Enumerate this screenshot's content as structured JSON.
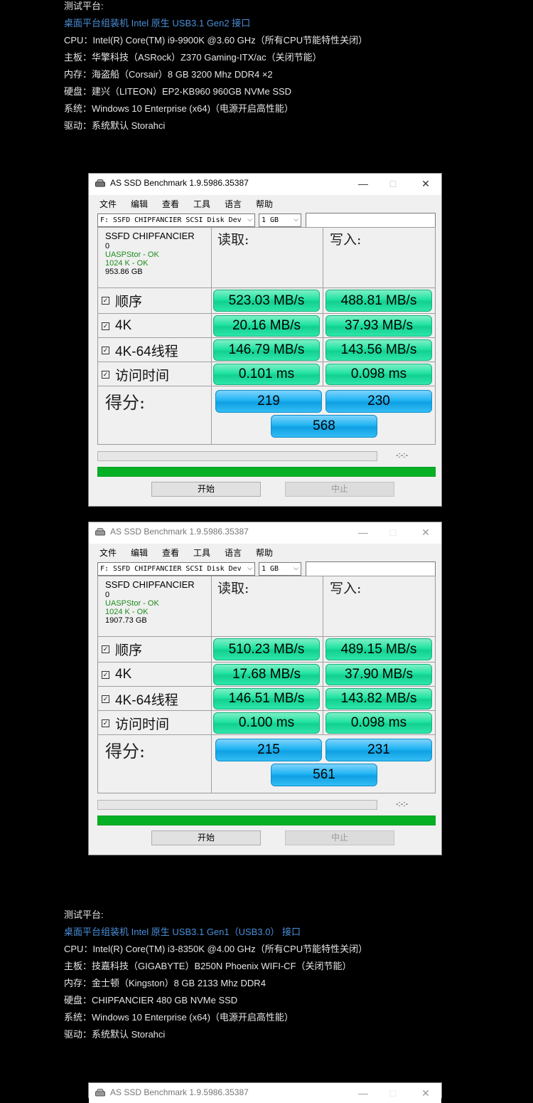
{
  "spec1": {
    "lines": [
      {
        "text": "测试平台:"
      },
      {
        "text": "桌面平台组装机 Intel 原生 USB3.1 Gen2 接口"
      },
      {
        "text": "CPU：Intel(R) Core(TM) i9-9900K @3.60 GHz（所有CPU节能特性关闭）"
      },
      {
        "text": "主板：华擎科技（ASRock）Z370 Gaming-ITX/ac（关闭节能）"
      },
      {
        "text": "内存：海盗船（Corsair）8 GB 3200 Mhz DDR4 ×2"
      },
      {
        "text": "硬盘：建兴（LITEON）EP2-KB960 960GB NVMe SSD"
      },
      {
        "text": "系统：Windows 10 Enterprise (x64)（电源开启高性能）"
      },
      {
        "text": "驱动：系统默认 Storahci"
      }
    ]
  },
  "spec2": {
    "lines": [
      {
        "text": "测试平台:"
      },
      {
        "text": "桌面平台组装机 Intel 原生 USB3.1 Gen1（USB3.0） 接口"
      },
      {
        "text": "CPU：Intel(R) Core(TM) i3-8350K @4.00 GHz（所有CPU节能特性关闭）"
      },
      {
        "text": "主板：技嘉科技（GIGABYTE）B250N Phoenix WIFI-CF（关闭节能）"
      },
      {
        "text": "内存：金士顿（Kingston）8 GB 2133 Mhz DDR4"
      },
      {
        "text": "硬盘：CHIPFANCIER 480 GB NVMe SSD"
      },
      {
        "text": "系统：Windows 10 Enterprise (x64)（电源开启高性能）"
      },
      {
        "text": "驱动：系统默认 Storahci"
      }
    ]
  },
  "common": {
    "title": "AS SSD Benchmark 1.9.5986.35387",
    "min": "—",
    "max": "□",
    "close": "✕",
    "menu": [
      "文件",
      "编辑",
      "查看",
      "工具",
      "语言",
      "帮助"
    ],
    "drive": "F: SSFD CHIPFANCIER SCSI Disk Dev",
    "size": "1 GB",
    "dev_name": "SSFD CHIPFANCIER",
    "dev_zero": "0",
    "uasp": "UASPStor - OK",
    "align": "1024 K - OK",
    "read_hdr": "读取:",
    "write_hdr": "写入:",
    "rows": [
      "顺序",
      "4K",
      "4K-64线程",
      "访问时间"
    ],
    "score_label": "得分:",
    "timer": "-:-:-",
    "start": "开始",
    "stop": "中止"
  },
  "win1": {
    "capacity": "953.86 GB",
    "read": [
      "523.03 MB/s",
      "20.16 MB/s",
      "146.79 MB/s",
      "0.101 ms"
    ],
    "write": [
      "488.81 MB/s",
      "37.93 MB/s",
      "143.56 MB/s",
      "0.098 ms"
    ],
    "score_read": "219",
    "score_write": "230",
    "score_total": "568"
  },
  "win2": {
    "capacity": "1907.73 GB",
    "read": [
      "510.23 MB/s",
      "17.68 MB/s",
      "146.51 MB/s",
      "0.100 ms"
    ],
    "write": [
      "489.15 MB/s",
      "37.90 MB/s",
      "143.82 MB/s",
      "0.098 ms"
    ],
    "score_read": "215",
    "score_write": "231",
    "score_total": "561"
  }
}
